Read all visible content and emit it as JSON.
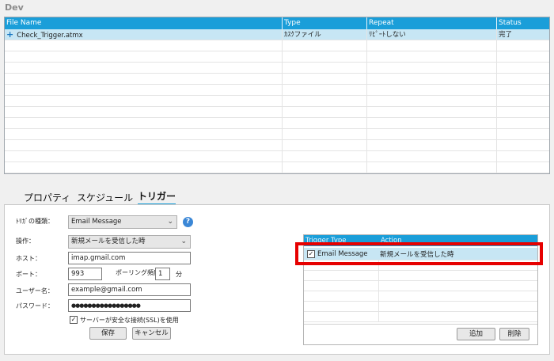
{
  "section_title": "Dev",
  "file_grid": {
    "columns": [
      "File Name",
      "Type",
      "Repeat",
      "Status"
    ],
    "rows": [
      {
        "file_name": "Check_Trigger.atmx",
        "type": "ｶｽｸファイル",
        "repeat": "ﾘﾋﾟｰﾄしない",
        "status": "完了"
      }
    ]
  },
  "tabs": [
    "プロパティ",
    "スケジュール",
    "トリガー"
  ],
  "active_tab": "トリガー",
  "form": {
    "trigger_type_label": "ﾄﾘｶﾞの種類：",
    "trigger_type_value": "Email Message",
    "operation_label": "操作：",
    "operation_value": "新規メールを受信した時",
    "host_label": "ホスト：",
    "host_value": "imap.gmail.com",
    "port_label": "ポート：",
    "port_value": "993",
    "polling_label": "ポーリング頻度",
    "polling_value": "1",
    "polling_unit": "分",
    "user_label": "ユーザー名：",
    "user_value": "example@gmail.com",
    "password_label": "パスワード：",
    "password_value": "●●●●●●●●●●●●●●●●●",
    "ssl_label": "サーバーが安全な接続(SSL)を使用",
    "ssl_checked": true,
    "save_label": "保存",
    "cancel_label": "キャンセル"
  },
  "trigger_list": {
    "columns": [
      "Trigger Type",
      "Action"
    ],
    "rows": [
      {
        "type": "Email Message",
        "action": "新規メールを受信した時",
        "checked": true
      }
    ],
    "add_label": "追加",
    "delete_label": "削除"
  },
  "colors": {
    "header_blue": "#1a9ed9",
    "selected_row": "#c7e6f4",
    "highlight_red": "#e60000"
  }
}
